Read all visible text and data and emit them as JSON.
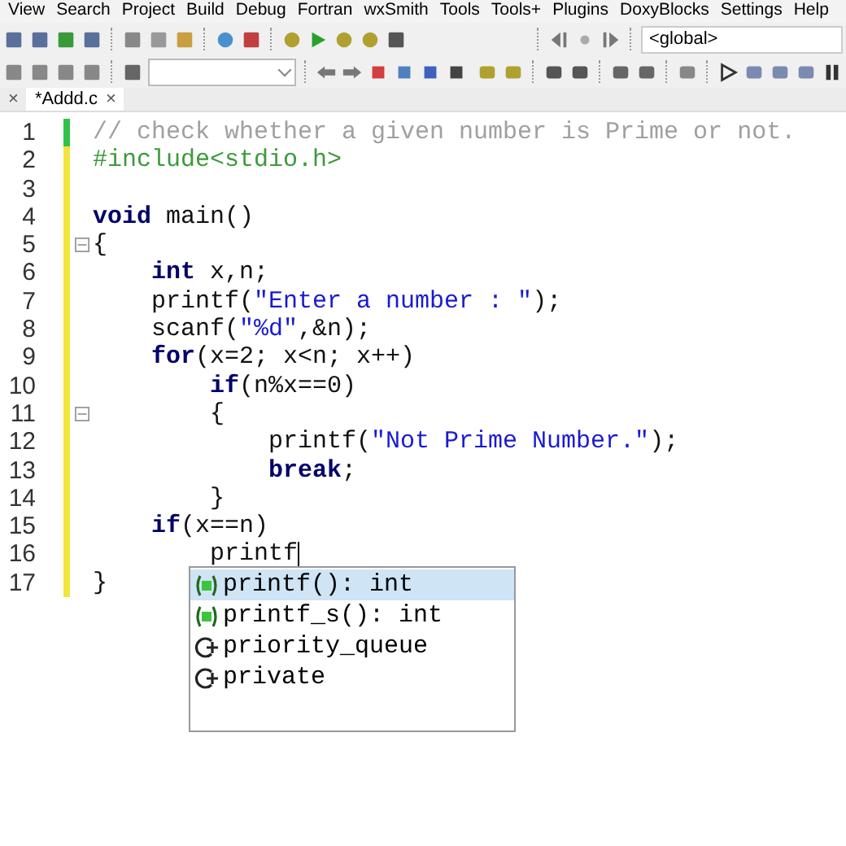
{
  "menu": [
    "View",
    "Search",
    "Project",
    "Build",
    "Debug",
    "Fortran",
    "wxSmith",
    "Tools",
    "Tools+",
    "Plugins",
    "DoxyBlocks",
    "Settings",
    "Help"
  ],
  "scope_dropdown": {
    "value": "<global>"
  },
  "tabs": [
    {
      "close": "×",
      "selected": false
    },
    {
      "label": "*Addd.c",
      "close": "×",
      "selected": true
    }
  ],
  "lines": [
    {
      "number": "1",
      "saved": true,
      "fold": false,
      "tokens": [
        {
          "kind": "comment",
          "text": "// check whether a given number is Prime or not."
        }
      ]
    },
    {
      "number": "2",
      "saved": false,
      "fold": false,
      "tokens": [
        {
          "kind": "preproc",
          "text": "#include<stdio.h>"
        }
      ]
    },
    {
      "number": "3",
      "saved": false,
      "fold": false
    },
    {
      "number": "4",
      "saved": false,
      "fold": false,
      "tokens": [
        {
          "kind": "keyword",
          "text": "void"
        },
        {
          "kind": "plain",
          "text": " main()"
        }
      ]
    },
    {
      "number": "5",
      "saved": false,
      "fold": true,
      "tokens": [
        {
          "kind": "plain",
          "text": "{"
        }
      ]
    },
    {
      "number": "6",
      "saved": false,
      "fold": false,
      "tokens": [
        {
          "kind": "keyword",
          "text": "    int"
        },
        {
          "kind": "plain",
          "text": " x,n;"
        }
      ]
    },
    {
      "number": "7",
      "saved": false,
      "fold": false,
      "tokens": [
        {
          "kind": "plain",
          "text": "    printf("
        },
        {
          "kind": "string",
          "text": "\"Enter a number : \""
        },
        {
          "kind": "plain",
          "text": ");"
        }
      ]
    },
    {
      "number": "8",
      "saved": false,
      "fold": false,
      "tokens": [
        {
          "kind": "plain",
          "text": "    scanf("
        },
        {
          "kind": "string",
          "text": "\"%d\""
        },
        {
          "kind": "plain",
          "text": ",&n);"
        }
      ]
    },
    {
      "number": "9",
      "saved": false,
      "fold": false,
      "tokens": [
        {
          "kind": "keyword",
          "text": "    for"
        },
        {
          "kind": "plain",
          "text": "(x=2; x<n; x++)"
        }
      ]
    },
    {
      "number": "10",
      "saved": false,
      "fold": false,
      "tokens": [
        {
          "kind": "keyword",
          "text": "        if"
        },
        {
          "kind": "plain",
          "text": "(n%x==0)"
        }
      ]
    },
    {
      "number": "11",
      "saved": false,
      "fold": true,
      "tokens": [
        {
          "kind": "plain",
          "text": "        {"
        }
      ]
    },
    {
      "number": "12",
      "saved": false,
      "fold": false,
      "tokens": [
        {
          "kind": "plain",
          "text": "            printf("
        },
        {
          "kind": "string",
          "text": "\"Not Prime Number.\""
        },
        {
          "kind": "plain",
          "text": ");"
        }
      ]
    },
    {
      "number": "13",
      "saved": false,
      "fold": false,
      "tokens": [
        {
          "kind": "keyword",
          "text": "            break"
        },
        {
          "kind": "plain",
          "text": ";"
        }
      ]
    },
    {
      "number": "14",
      "saved": false,
      "fold": false,
      "tokens": [
        {
          "kind": "plain",
          "text": "        }"
        }
      ]
    },
    {
      "number": "15",
      "saved": false,
      "fold": false,
      "tokens": [
        {
          "kind": "keyword",
          "text": "    if"
        },
        {
          "kind": "plain",
          "text": "(x==n)"
        }
      ]
    },
    {
      "number": "16",
      "saved": false,
      "fold": false,
      "caret": true,
      "tokens": [
        {
          "kind": "plain",
          "text": "        printf"
        }
      ]
    },
    {
      "number": "17",
      "saved": false,
      "fold": false,
      "tokens": [
        {
          "kind": "plain",
          "text": "}"
        }
      ]
    }
  ],
  "autocomplete": [
    {
      "kind": "function",
      "label": "printf(): int",
      "selected": true
    },
    {
      "kind": "function",
      "label": "printf_s(): int",
      "selected": false
    },
    {
      "kind": "class",
      "label": "priority_queue",
      "selected": false
    },
    {
      "kind": "class",
      "label": "private",
      "selected": false
    }
  ]
}
